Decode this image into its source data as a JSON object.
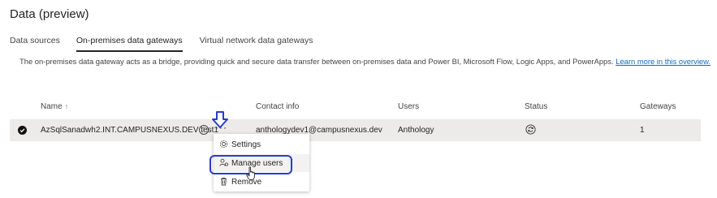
{
  "page": {
    "title": "Data (preview)"
  },
  "tabs": [
    {
      "label": "Data sources"
    },
    {
      "label": "On-premises data gateways"
    },
    {
      "label": "Virtual network data gateways"
    }
  ],
  "description": {
    "text": "The on-premises data gateway acts as a bridge, providing quick and secure data transfer between on-premises data and Power BI, Microsoft Flow, Logic Apps, and PowerApps. ",
    "link": "Learn more in this overview."
  },
  "table": {
    "headers": {
      "name": "Name",
      "sort_icon": "↑",
      "contact": "Contact info",
      "users": "Users",
      "status": "Status",
      "gateways": "Gateways"
    },
    "rows": [
      {
        "name": "AzSqlSanadwh2.INT.CAMPUSNEXUS.DEV test1",
        "contact": "anthologydev1@campusnexus.dev",
        "users": "Anthology",
        "status_icon": "refresh-circle-icon",
        "gateways": "1",
        "more": "···",
        "info": "i"
      }
    ]
  },
  "context_menu": {
    "items": [
      {
        "label": "Settings",
        "icon": "gear-icon"
      },
      {
        "label": "Manage users",
        "icon": "manage-users-icon"
      },
      {
        "label": "Remove",
        "icon": "trash-icon"
      }
    ]
  },
  "colors": {
    "accent_link": "#0f6cbd",
    "annotation_blue": "#2b3dc8",
    "row_selected_bg": "#edebe9"
  }
}
